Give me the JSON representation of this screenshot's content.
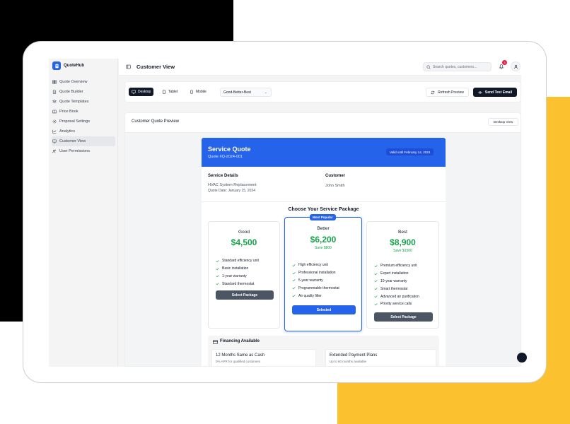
{
  "brand": {
    "name": "QuoteHub"
  },
  "sidebar": {
    "items": [
      {
        "label": "Quote Overview",
        "icon": "layout-icon",
        "active": false
      },
      {
        "label": "Quote Builder",
        "icon": "document-icon",
        "active": false
      },
      {
        "label": "Quote Templates",
        "icon": "layers-icon",
        "active": false
      },
      {
        "label": "Price Book",
        "icon": "book-icon",
        "active": false
      },
      {
        "label": "Proposal Settings",
        "icon": "settings-icon",
        "active": false
      },
      {
        "label": "Analytics",
        "icon": "chart-icon",
        "active": false
      },
      {
        "label": "Customer View",
        "icon": "monitor-icon",
        "active": true
      },
      {
        "label": "User Permissions",
        "icon": "users-icon",
        "active": false
      }
    ]
  },
  "header": {
    "title": "Customer View",
    "search_placeholder": "Search quotes, customers...",
    "notification_count": "3"
  },
  "toolbar": {
    "devices": [
      {
        "label": "Desktop",
        "active": true
      },
      {
        "label": "Tablet",
        "active": false
      },
      {
        "label": "Mobile",
        "active": false
      }
    ],
    "template_select": "Good-Better-Best",
    "refresh_label": "Refresh Preview",
    "send_label": "Send Test Email"
  },
  "preview": {
    "title": "Customer Quote Preview",
    "mode_button": "Desktop View"
  },
  "quote": {
    "title": "Service Quote",
    "number": "Quote #Q-2024-001",
    "valid_until": "Valid until February 14, 2024",
    "service_details_label": "Service Details",
    "service_name": "HVAC System Replacement",
    "quote_date": "Quote Date: January 15, 2024",
    "customer_label": "Customer",
    "customer_name": "John Smith",
    "choose_label": "Choose Your Service Package",
    "packages": [
      {
        "name": "Good",
        "price": "$4,500",
        "save": "",
        "popular": false,
        "features": [
          "Standard efficiency unit",
          "Basic installation",
          "1-year warranty",
          "Standard thermostat"
        ],
        "button": "Select Package"
      },
      {
        "name": "Better",
        "price": "$6,200",
        "save": "Save $800",
        "popular": true,
        "popular_label": "Most Popular",
        "features": [
          "High efficiency unit",
          "Professional installation",
          "5-year warranty",
          "Programmable thermostat",
          "Air quality filter"
        ],
        "button": "Selected"
      },
      {
        "name": "Best",
        "price": "$8,900",
        "save": "Save $1500",
        "popular": false,
        "features": [
          "Premium efficiency unit",
          "Expert installation",
          "10-year warranty",
          "Smart thermostat",
          "Advanced air purification",
          "Priority service calls"
        ],
        "button": "Select Package"
      }
    ],
    "financing": {
      "title": "Financing Available",
      "options": [
        {
          "title": "12 Months Same as Cash",
          "sub": "0% APR for qualified customers"
        },
        {
          "title": "Extended Payment Plans",
          "sub": "Up to 60 months available"
        }
      ]
    }
  },
  "colors": {
    "accent": "#2563eb",
    "price_green": "#16a34a",
    "dark": "#111827",
    "backdrop_black": "#000000",
    "backdrop_yellow": "#fcc12f"
  }
}
